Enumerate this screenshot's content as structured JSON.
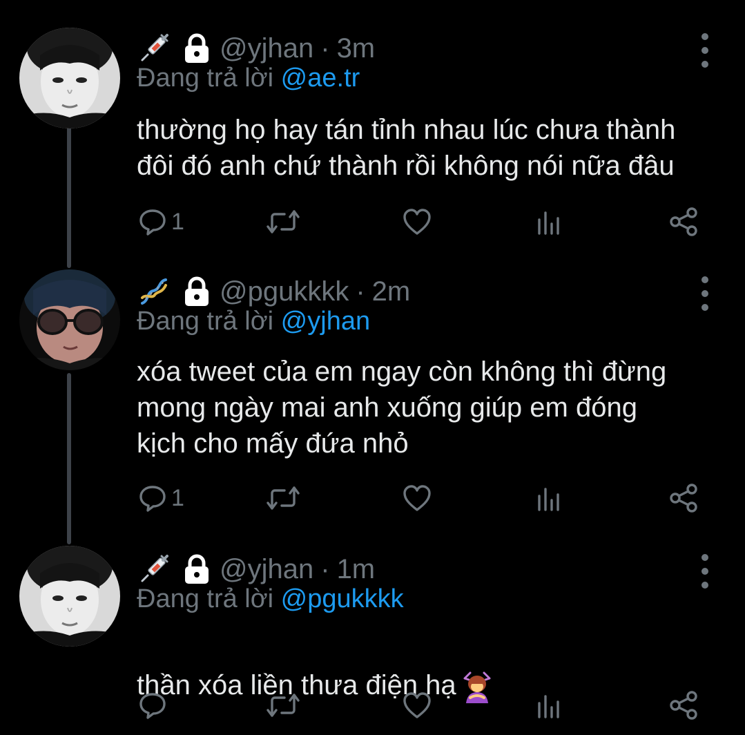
{
  "tweets": [
    {
      "handle": "@yjhan",
      "separator": "·",
      "time": "3m",
      "reply_prefix": "Đang trả lời",
      "reply_to": "@ae.tr",
      "text": "thường họ hay tán tỉnh nhau lúc chưa thành\nđôi đó anh chứ thành rồi không nói nữa đâu",
      "reply_count": "1",
      "badge_icon": "syringe-emoji",
      "avatar": "avatar-yjhan"
    },
    {
      "handle": "@pgukkkk",
      "separator": "·",
      "time": "2m",
      "reply_prefix": "Đang trả lời",
      "reply_to": "@yjhan",
      "text": "xóa tweet của em ngay còn không thì đừng\nmong ngày mai anh xuống giúp em đóng\nkịch cho mấy đứa nhỏ",
      "reply_count": "1",
      "badge_icon": "dna-emoji",
      "avatar": "avatar-pgukkkk"
    },
    {
      "handle": "@yjhan",
      "separator": "·",
      "time": "1m",
      "reply_prefix": "Đang trả lời",
      "reply_to": "@pgukkkk",
      "text": "thần xóa liền thưa điện hạ",
      "reply_count": "",
      "badge_icon": "syringe-emoji",
      "avatar": "avatar-yjhan",
      "trailing_emoji": "person-bowing-emoji"
    }
  ],
  "colors": {
    "background": "#000000",
    "text": "#e7e9ea",
    "muted": "#6e767d",
    "mention": "#1d9bf0",
    "thread_line": "#3d4249"
  },
  "icons": [
    "more-icon",
    "reply-icon",
    "retweet-icon",
    "like-icon",
    "analytics-icon",
    "share-icon",
    "lock-icon"
  ]
}
